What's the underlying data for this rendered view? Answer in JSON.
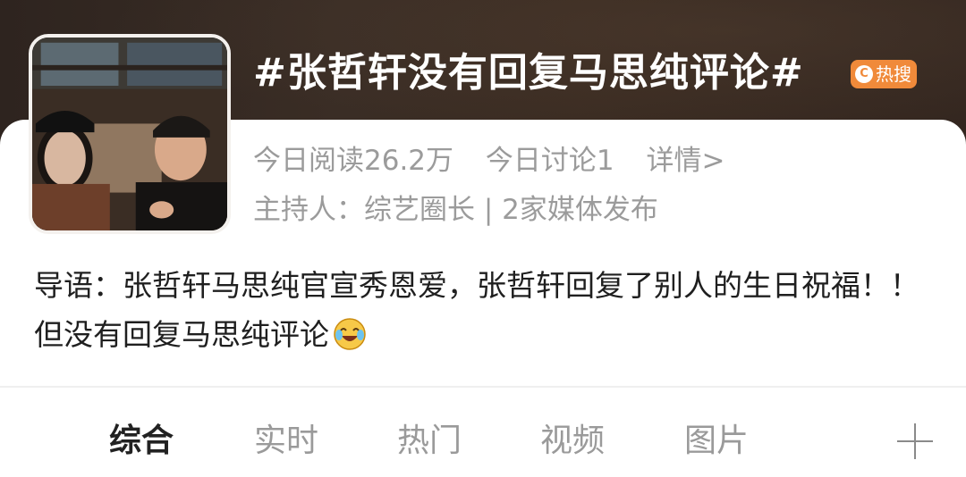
{
  "topic": {
    "title": "#张哲轩没有回复马思纯评论#",
    "badge": "热搜",
    "badge_color": "#f08a3a"
  },
  "stats": {
    "read": "今日阅读26.2万",
    "discuss": "今日讨论1",
    "detail": "详情>"
  },
  "host": {
    "text": "主持人：综艺圈长 | 2家媒体发布"
  },
  "intro": {
    "text": "导语：张哲轩马思纯官宣秀恩爱，张哲轩回复了别人的生日祝福！！但没有回复马思纯评论",
    "emoji": "laughing-crying-emoji"
  },
  "tabs": [
    {
      "label": "综合",
      "active": true
    },
    {
      "label": "实时",
      "active": false
    },
    {
      "label": "热门",
      "active": false
    },
    {
      "label": "视频",
      "active": false
    },
    {
      "label": "图片",
      "active": false
    }
  ]
}
